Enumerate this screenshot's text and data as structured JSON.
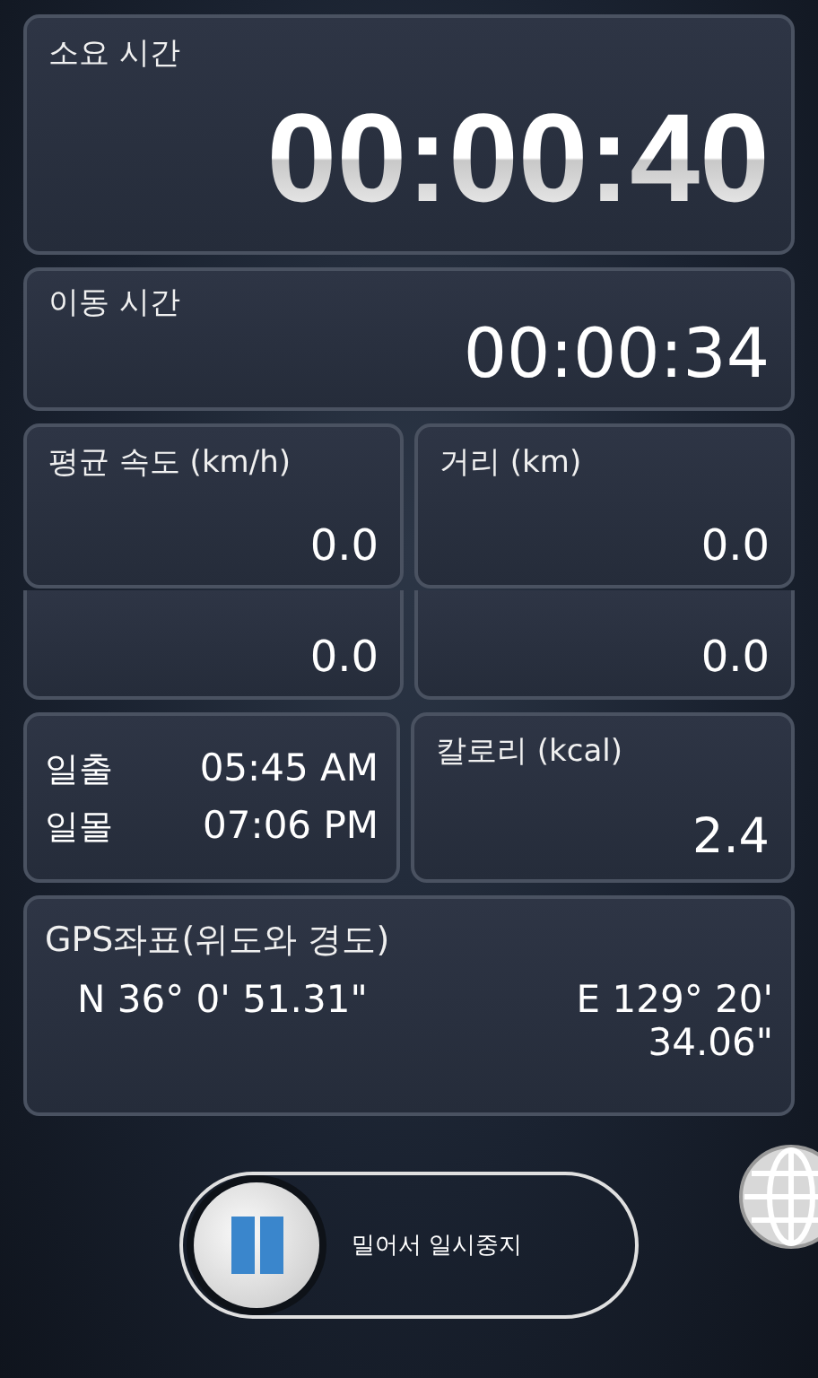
{
  "timers": [
    {
      "kind": "large",
      "label": "소요 시간",
      "value": "00:00:40"
    },
    {
      "kind": "medium",
      "label": "이동 시간",
      "value": "00:00:34"
    }
  ],
  "stats": [
    {
      "label": "평균 속도 (km/h)",
      "value": "0.0"
    },
    {
      "label": "거리 (km)",
      "value": "0.0"
    }
  ],
  "partial_stats": [
    {
      "value": "0.0"
    },
    {
      "value": "0.0"
    }
  ],
  "sun": [
    {
      "label": "일출",
      "time": "05:45 AM"
    },
    {
      "label": "일몰",
      "time": "07:06 PM"
    }
  ],
  "calories": {
    "label": "칼로리 (kcal)",
    "value": "2.4"
  },
  "gps": {
    "label": "GPS좌표(위도와 경도)",
    "latitude": "N 36° 0' 51.31\"",
    "longitude": "E 129° 20' 34.06\""
  },
  "slider": {
    "label": "밀어서 일시중지"
  }
}
